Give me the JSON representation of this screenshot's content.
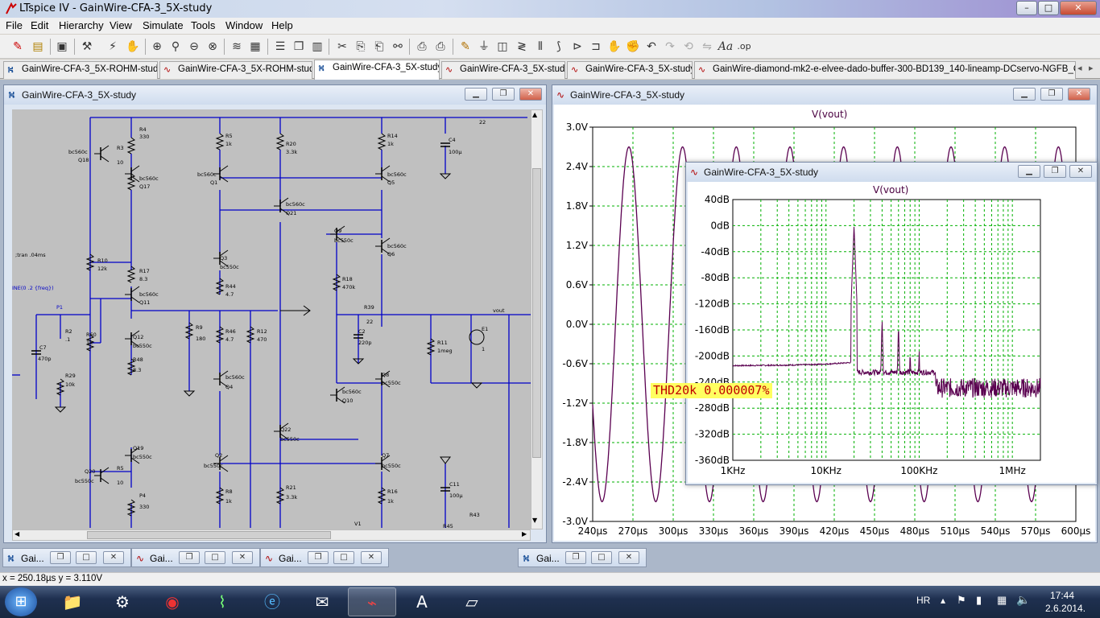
{
  "window": {
    "title": "LTspice IV - GainWire-CFA-3_5X-study",
    "min_label": "–",
    "max_label": "□",
    "close_label": "✕"
  },
  "menu": [
    "File",
    "Edit",
    "Hierarchy",
    "View",
    "Simulate",
    "Tools",
    "Window",
    "Help"
  ],
  "tabs": [
    {
      "label": "GainWire-CFA-3_5X-ROHM-study",
      "icon": "schematic-icon"
    },
    {
      "label": "GainWire-CFA-3_5X-ROHM-study",
      "icon": "waveform-icon"
    },
    {
      "label": "GainWire-CFA-3_5X-study",
      "icon": "schematic-icon"
    },
    {
      "label": "GainWire-CFA-3_5X-study",
      "icon": "waveform-icon"
    },
    {
      "label": "GainWire-CFA-3_5X-study",
      "icon": "waveform-icon"
    },
    {
      "label": "GainWire-diamond-mk2-e-elvee-dado-buffer-300-BD139_140-lineamp-DCservo-NGFB_CFA-3_",
      "icon": "waveform-icon"
    }
  ],
  "schematic": {
    "title": "GainWire-CFA-3_5X-study",
    "labels": {
      "tran": ";tran .04ms",
      "sine": "INE(0 .2 {freq})",
      "p1": "P1",
      "vout": "vout",
      "r4": "R4",
      "r4v": "330",
      "r5": "R5",
      "r5v": "1k",
      "r20": "R20",
      "r20v": "3.3k",
      "r14": "R14",
      "r14v": "1k",
      "c4": "C4",
      "c4v": "100µ",
      "r22": "22",
      "q18": "Q18",
      "q18m": "bc560c",
      "r3": "R3",
      "r3v": "10",
      "q17": "Q17",
      "q17m": "bc560c",
      "q1": "Q1",
      "q1m": "bc560c",
      "q5": "Q5",
      "q5m": "bc560c",
      "q21": "Q21",
      "q21m": "bc560c",
      "q9": "Q9",
      "q9m": "bc550c",
      "q6": "Q6",
      "q6m": "bc560c",
      "r10": "R10",
      "r10v": "12k",
      "q3": "Q3",
      "q3m": "bc550c",
      "r17": "R17",
      "r17v": "8.3",
      "r18": "R18",
      "r18v": "470k",
      "q11": "Q11",
      "q11m": "bc560c",
      "r44": "R44",
      "r44v": "4.7",
      "r39": "R39",
      "r39v": "22",
      "r2": "R2",
      "r2v": ".1",
      "r60": "R60",
      "r60v": "1k",
      "q12": "Q12",
      "q12m": "bc550c",
      "r9": "R9",
      "r9v": "180",
      "r46": "R46",
      "r46v": "4.7",
      "r12": "R12",
      "r12v": "470",
      "c2": "C2",
      "c2v": "220p",
      "r11": "R11",
      "r11v": "1meg",
      "e1": "E1",
      "e1v": "1",
      "c7": "C7",
      "c7v": "470p",
      "r48": "R48",
      "r48v": "8.3",
      "r29": "R29",
      "r29v": "10k",
      "q4": "Q4",
      "q4m": "bc560c",
      "q8": "Q8",
      "q8m": "bc550c",
      "q10": "Q10",
      "q10m": "bc560c",
      "q22": "Q22",
      "q22m": "bc550c",
      "q19": "Q19",
      "q19m": "bc550c",
      "q20": "Q20",
      "q20m": "bc550c",
      "r5b": "R5",
      "r5bv": "10",
      "q2": "Q2",
      "q2m": "bc550c",
      "q7": "Q7",
      "q7m": "bc550c",
      "r8": "R8",
      "r8v": "1k",
      "r21": "R21",
      "r21v": "3.3k",
      "r16": "R16",
      "r16v": "1k",
      "c11": "C11",
      "c11v": "100µ",
      "p4": "P4",
      "p4v": "330",
      "r43": "R43",
      "r45": "R45",
      "v1": "V1"
    }
  },
  "transient": {
    "title": "GainWire-CFA-3_5X-study",
    "trace": "V(vout)",
    "trace_color": "#5a0050",
    "grid_color": "#00b000",
    "chart_data": {
      "type": "line",
      "x_unit": "µs",
      "xlim": [
        240,
        600
      ],
      "ylim": [
        -3.0,
        3.0
      ],
      "x_ticks": [
        "240µs",
        "270µs",
        "300µs",
        "330µs",
        "360µs",
        "390µs",
        "420µs",
        "450µs",
        "480µs",
        "510µs",
        "540µs",
        "570µs",
        "600µs"
      ],
      "y_ticks": [
        "3.0V",
        "2.4V",
        "1.8V",
        "1.2V",
        "0.6V",
        "0.0V",
        "-0.6V",
        "-1.2V",
        "-1.8V",
        "-2.4V",
        "-3.0V"
      ],
      "series": [
        {
          "period_us": 40,
          "amplitude_V": 2.7,
          "peak_at_us": 267
        }
      ]
    }
  },
  "fft": {
    "title": "GainWire-CFA-3_5X-study",
    "trace": "V(vout)",
    "annotation": "THD20k  0.000007%",
    "chart_data": {
      "type": "line",
      "x_scale": "log",
      "xlim": [
        "1KHz",
        "2MHz"
      ],
      "ylim": [
        -360,
        40
      ],
      "x_ticks": [
        "1KHz",
        "10KHz",
        "100KHz",
        "1MHz"
      ],
      "y_ticks": [
        "40dB",
        "0dB",
        "-40dB",
        "-80dB",
        "-120dB",
        "-160dB",
        "-200dB",
        "-240dB",
        "-280dB",
        "-320dB",
        "-360dB"
      ],
      "fundamental_hz": 20000,
      "fundamental_db": 0,
      "noise_floor_db": -215,
      "harmonics_db": [
        [
          40000,
          -142
        ],
        [
          60000,
          -150
        ],
        [
          80000,
          -190
        ],
        [
          100000,
          -190
        ]
      ]
    }
  },
  "minimized": [
    {
      "label": "Gai...",
      "icon": "schematic-icon"
    },
    {
      "label": "Gai...",
      "icon": "waveform-icon"
    },
    {
      "label": "Gai...",
      "icon": "waveform-icon"
    },
    {
      "label": "Gai...",
      "icon": "schematic-icon"
    }
  ],
  "status": "x = 250.18µs   y = 3.110V",
  "taskbar": {
    "lang": "HR",
    "time": "17:44",
    "date": "2.6.2014."
  }
}
